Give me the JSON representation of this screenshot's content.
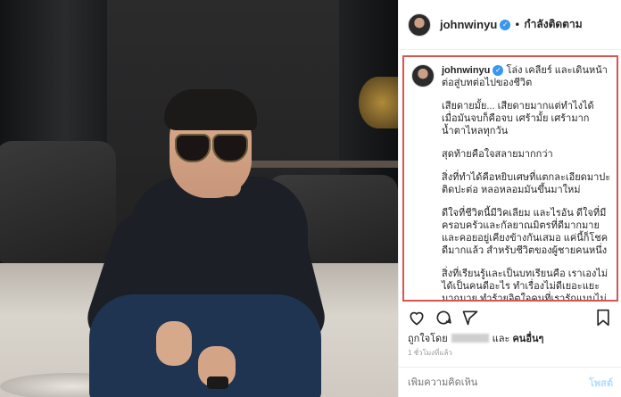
{
  "post": {
    "username": "johnwinyu",
    "verified_mark": "✓",
    "follow_separator": "•",
    "follow_status": "กำลังติดตาม",
    "caption_heading": "โล่ง เคลียร์ และเดินหน้าต่อสู่บทต่อไปของชีวิต",
    "caption_paragraphs": [
      "เสียดายมั้ย... เสียดายมากแต่ทำไงได้ เมื่อมันจบก็คือจบ เศร้ามั้ย เศร้ามาก น้ำตาไหลทุกวัน",
      "สุดท้ายคือใจสลายมากกว่า",
      "สิ่งที่ทำได้คือหยิบเศษที่แตกละเอียดมาปะติดปะต่อ หลอหลอมมันขึ้นมาใหม่",
      "ดีใจที่ชีวิตนี้มีวิคเลียม และไรอัน ดีใจที่มีครอบครัวและกัลยาณมิตรที่ดีมากมาย และคอยอยู่เคียงข้างกันเสมอ แค่นี้ก็โชคดีมากแล้ว สำหรับชีวิตของผู้ชายคนหนึ่ง",
      "สิ่งที่เรียนรู้และเป็นบทเรียนคือ เราเองไม่ได้เป็นคนดีอะไร ทำเรื่องไม่ดีเยอะแยะมากมาย ทำร้ายจิตใจคนที่เรารักแบบไม่"
    ],
    "liked_by_prefix": "ถูกใจโดย",
    "liked_by_joiner": "และ",
    "liked_by_others": "คนอื่นๆ",
    "timestamp": "1 ชั่วโมงที่แล้ว",
    "comment_placeholder": "เพิ่มความคิดเห็น",
    "post_button": "โพสต์"
  },
  "icons": {
    "like": "heart-icon",
    "comment": "comment-icon",
    "share": "share-icon",
    "save": "bookmark-icon"
  },
  "colors": {
    "verified": "#3897f0",
    "highlight_border": "#d9534f",
    "post_button_disabled": "#b2dffc"
  }
}
